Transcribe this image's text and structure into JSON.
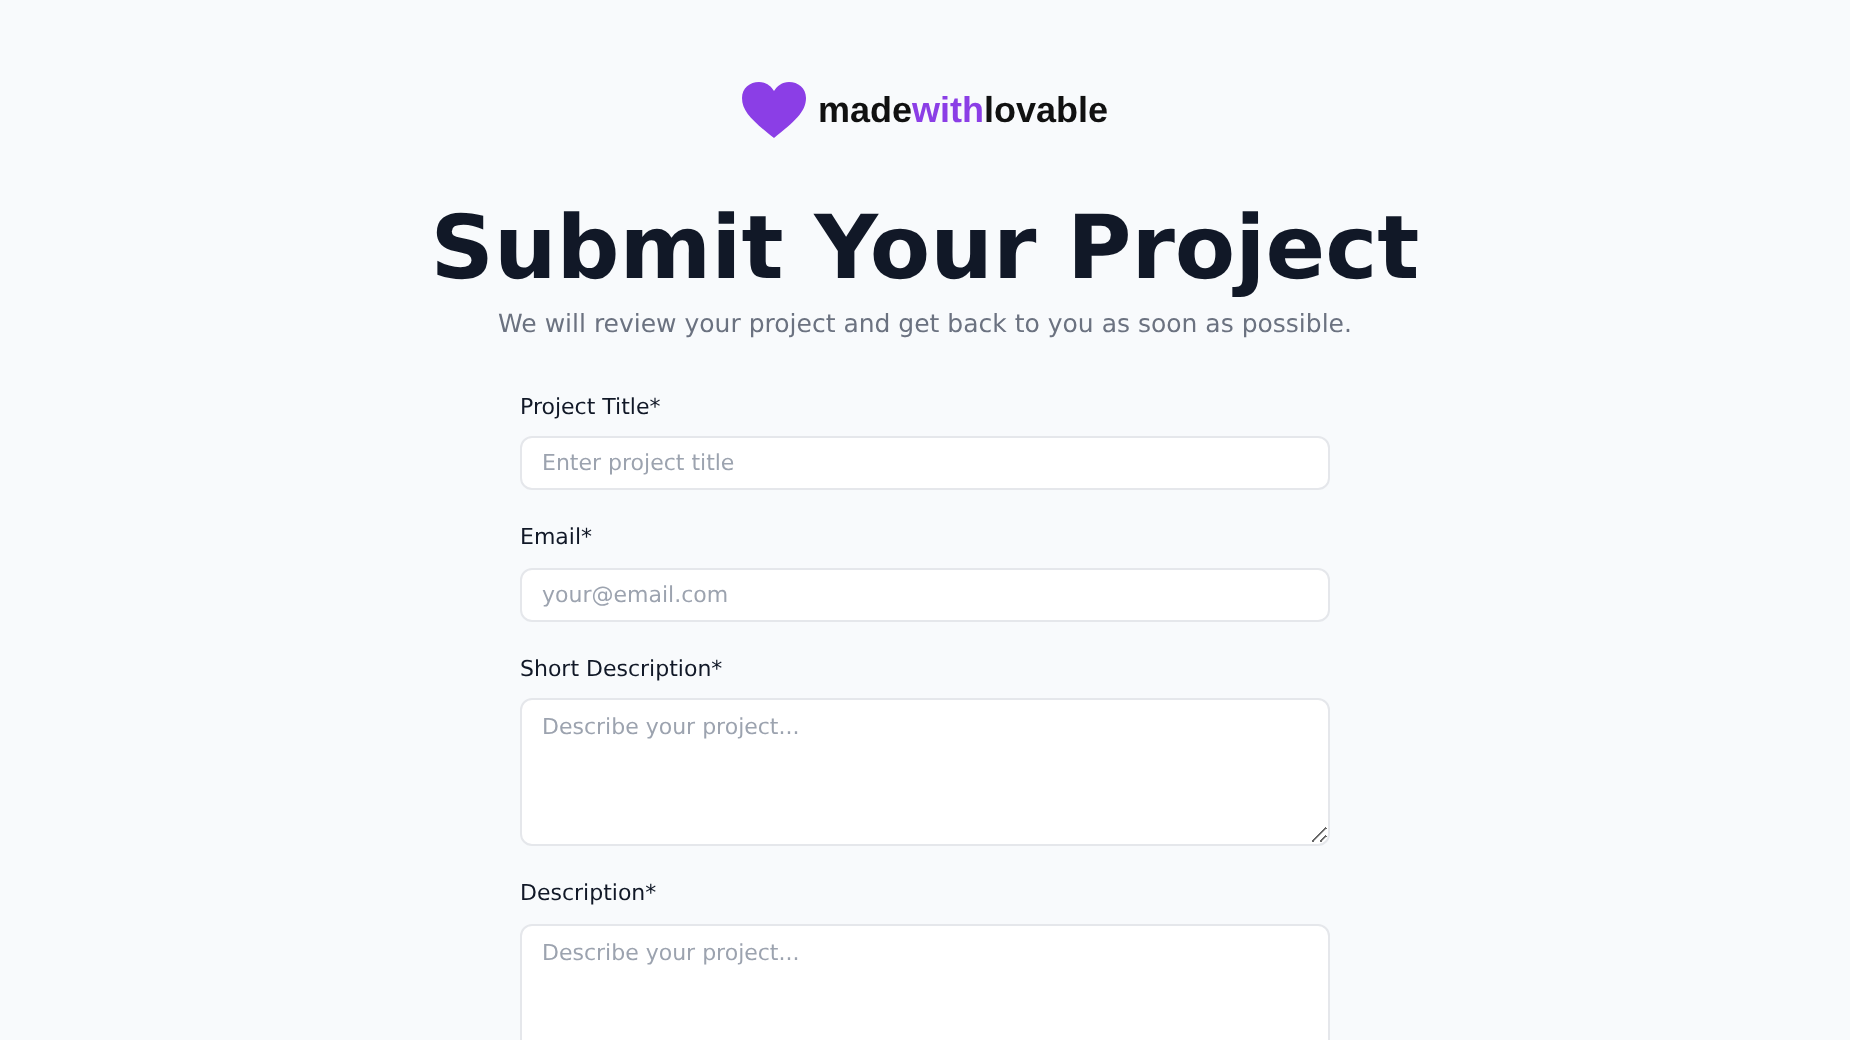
{
  "logo": {
    "prefix": "made",
    "highlight": "with",
    "suffix": "lovable"
  },
  "heading": "Submit Your Project",
  "subtitle": "We will review your project and get back to you as soon as possible.",
  "fields": [
    {
      "kind": "input",
      "label": "Project Title*",
      "placeholder": "Enter project title"
    },
    {
      "kind": "input",
      "label": "Email*",
      "placeholder": "your@email.com"
    },
    {
      "kind": "textarea",
      "label": "Short Description*",
      "placeholder": "Describe your project..."
    },
    {
      "kind": "textarea",
      "label": "Description*",
      "placeholder": "Describe your project..."
    }
  ]
}
